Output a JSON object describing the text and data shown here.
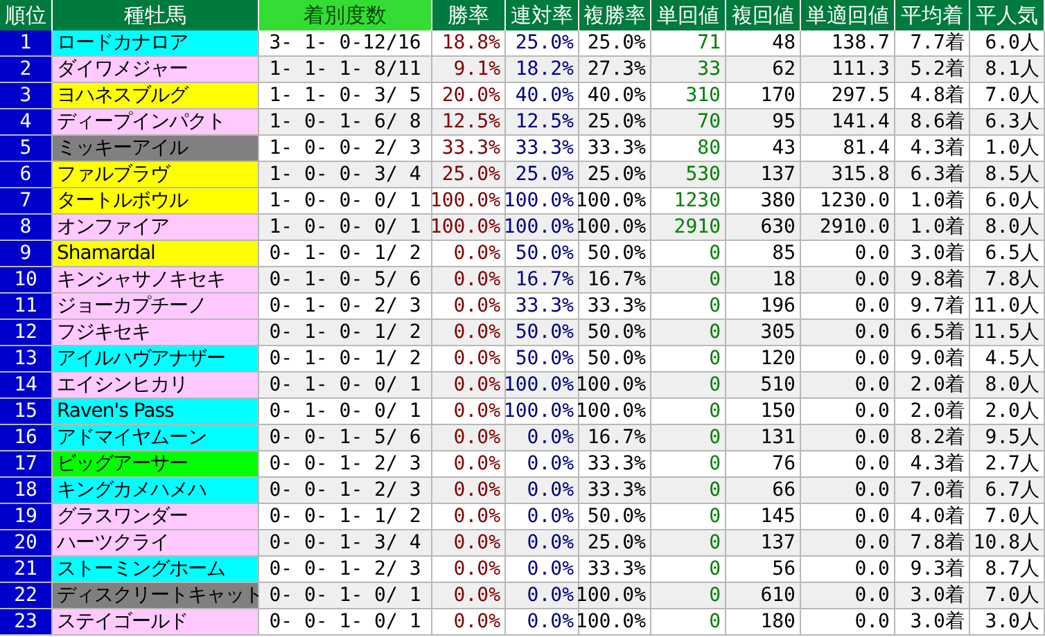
{
  "columns": [
    {
      "label": "順位",
      "selected": false
    },
    {
      "label": "種牡馬",
      "selected": false
    },
    {
      "label": "着別度数",
      "selected": true
    },
    {
      "label": "勝率",
      "selected": false
    },
    {
      "label": "連対率",
      "selected": false
    },
    {
      "label": "複勝率",
      "selected": false
    },
    {
      "label": "単回値",
      "selected": false
    },
    {
      "label": "複回値",
      "selected": false
    },
    {
      "label": "単適回値",
      "selected": false
    },
    {
      "label": "平均着",
      "selected": false
    },
    {
      "label": "平人気",
      "selected": false
    }
  ],
  "rows": [
    {
      "cells": [
        "1",
        "ロードカナロア",
        "3- 1- 0-12/16",
        "18.8%",
        "25.0%",
        "25.0%",
        "71",
        "48",
        "138.7",
        "7.7着",
        "6.0人"
      ],
      "color": "#00ffff"
    },
    {
      "cells": [
        "2",
        "ダイワメジャー",
        "1- 1- 1- 8/11",
        "9.1%",
        "18.2%",
        "27.3%",
        "33",
        "62",
        "111.3",
        "5.2着",
        "8.1人"
      ],
      "color": "#ffc8ff"
    },
    {
      "cells": [
        "3",
        "ヨハネスブルグ",
        "1- 1- 0- 3/ 5",
        "20.0%",
        "40.0%",
        "40.0%",
        "310",
        "170",
        "297.5",
        "4.8着",
        "7.0人"
      ],
      "color": "#ffff00"
    },
    {
      "cells": [
        "4",
        "ディープインパクト",
        "1- 0- 1- 6/ 8",
        "12.5%",
        "12.5%",
        "25.0%",
        "70",
        "95",
        "141.4",
        "8.6着",
        "6.3人"
      ],
      "color": "#ffc8ff"
    },
    {
      "cells": [
        "5",
        "ミッキーアイル",
        "1- 0- 0- 2/ 3",
        "33.3%",
        "33.3%",
        "33.3%",
        "80",
        "43",
        "81.4",
        "4.3着",
        "1.0人"
      ],
      "color": "#808080"
    },
    {
      "cells": [
        "6",
        "ファルブラヴ",
        "1- 0- 0- 3/ 4",
        "25.0%",
        "25.0%",
        "25.0%",
        "530",
        "137",
        "315.8",
        "6.3着",
        "8.5人"
      ],
      "color": "#ffff00"
    },
    {
      "cells": [
        "7",
        "タートルボウル",
        "1- 0- 0- 0/ 1",
        "100.0%",
        "100.0%",
        "100.0%",
        "1230",
        "380",
        "1230.0",
        "1.0着",
        "6.0人"
      ],
      "color": "#ffff00"
    },
    {
      "cells": [
        "8",
        "オンファイア",
        "1- 0- 0- 0/ 1",
        "100.0%",
        "100.0%",
        "100.0%",
        "2910",
        "630",
        "2910.0",
        "1.0着",
        "8.0人"
      ],
      "color": "#ffc8ff"
    },
    {
      "cells": [
        "9",
        "Shamardal",
        "0- 1- 0- 1/ 2",
        "0.0%",
        "50.0%",
        "50.0%",
        "0",
        "85",
        "0.0",
        "3.0着",
        "6.5人"
      ],
      "color": "#ffff00"
    },
    {
      "cells": [
        "10",
        "キンシャサノキセキ",
        "0- 1- 0- 5/ 6",
        "0.0%",
        "16.7%",
        "16.7%",
        "0",
        "18",
        "0.0",
        "9.8着",
        "7.8人"
      ],
      "color": "#ffc8ff"
    },
    {
      "cells": [
        "11",
        "ジョーカプチーノ",
        "0- 1- 0- 2/ 3",
        "0.0%",
        "33.3%",
        "33.3%",
        "0",
        "196",
        "0.0",
        "9.7着",
        "11.0人"
      ],
      "color": "#ffc8ff"
    },
    {
      "cells": [
        "12",
        "フジキセキ",
        "0- 1- 0- 1/ 2",
        "0.0%",
        "50.0%",
        "50.0%",
        "0",
        "305",
        "0.0",
        "6.5着",
        "11.5人"
      ],
      "color": "#ffc8ff"
    },
    {
      "cells": [
        "13",
        "アイルハヴアナザー",
        "0- 1- 0- 1/ 2",
        "0.0%",
        "50.0%",
        "50.0%",
        "0",
        "120",
        "0.0",
        "9.0着",
        "4.5人"
      ],
      "color": "#00ffff"
    },
    {
      "cells": [
        "14",
        "エイシンヒカリ",
        "0- 1- 0- 0/ 1",
        "0.0%",
        "100.0%",
        "100.0%",
        "0",
        "510",
        "0.0",
        "2.0着",
        "8.0人"
      ],
      "color": "#ffc8ff"
    },
    {
      "cells": [
        "15",
        "Raven's Pass",
        "0- 1- 0- 0/ 1",
        "0.0%",
        "100.0%",
        "100.0%",
        "0",
        "150",
        "0.0",
        "2.0着",
        "2.0人"
      ],
      "color": "#00ffff"
    },
    {
      "cells": [
        "16",
        "アドマイヤムーン",
        "0- 0- 1- 5/ 6",
        "0.0%",
        "0.0%",
        "16.7%",
        "0",
        "131",
        "0.0",
        "8.2着",
        "9.5人"
      ],
      "color": "#00ffff"
    },
    {
      "cells": [
        "17",
        "ビッグアーサー",
        "0- 0- 1- 2/ 3",
        "0.0%",
        "0.0%",
        "33.3%",
        "0",
        "76",
        "0.0",
        "4.3着",
        "2.7人"
      ],
      "color": "#00ff00"
    },
    {
      "cells": [
        "18",
        "キングカメハメハ",
        "0- 0- 1- 2/ 3",
        "0.0%",
        "0.0%",
        "33.3%",
        "0",
        "66",
        "0.0",
        "7.0着",
        "6.7人"
      ],
      "color": "#00ffff"
    },
    {
      "cells": [
        "19",
        "グラスワンダー",
        "0- 0- 1- 1/ 2",
        "0.0%",
        "0.0%",
        "50.0%",
        "0",
        "145",
        "0.0",
        "4.0着",
        "7.0人"
      ],
      "color": "#ffc8ff"
    },
    {
      "cells": [
        "20",
        "ハーツクライ",
        "0- 0- 1- 3/ 4",
        "0.0%",
        "0.0%",
        "25.0%",
        "0",
        "137",
        "0.0",
        "7.8着",
        "10.8人"
      ],
      "color": "#ffc8ff"
    },
    {
      "cells": [
        "21",
        "ストーミングホーム",
        "0- 0- 1- 2/ 3",
        "0.0%",
        "0.0%",
        "33.3%",
        "0",
        "56",
        "0.0",
        "9.3着",
        "8.7人"
      ],
      "color": "#00ffff"
    },
    {
      "cells": [
        "22",
        "ディスクリートキャット",
        "0- 0- 1- 0/ 1",
        "0.0%",
        "0.0%",
        "100.0%",
        "0",
        "610",
        "0.0",
        "3.0着",
        "7.0人"
      ],
      "color": "#808080"
    },
    {
      "cells": [
        "23",
        "ステイゴールド",
        "0- 0- 1- 0/ 1",
        "0.0%",
        "0.0%",
        "100.0%",
        "0",
        "180",
        "0.0",
        "3.0着",
        "3.0人"
      ],
      "color": "#ffc8ff"
    }
  ]
}
